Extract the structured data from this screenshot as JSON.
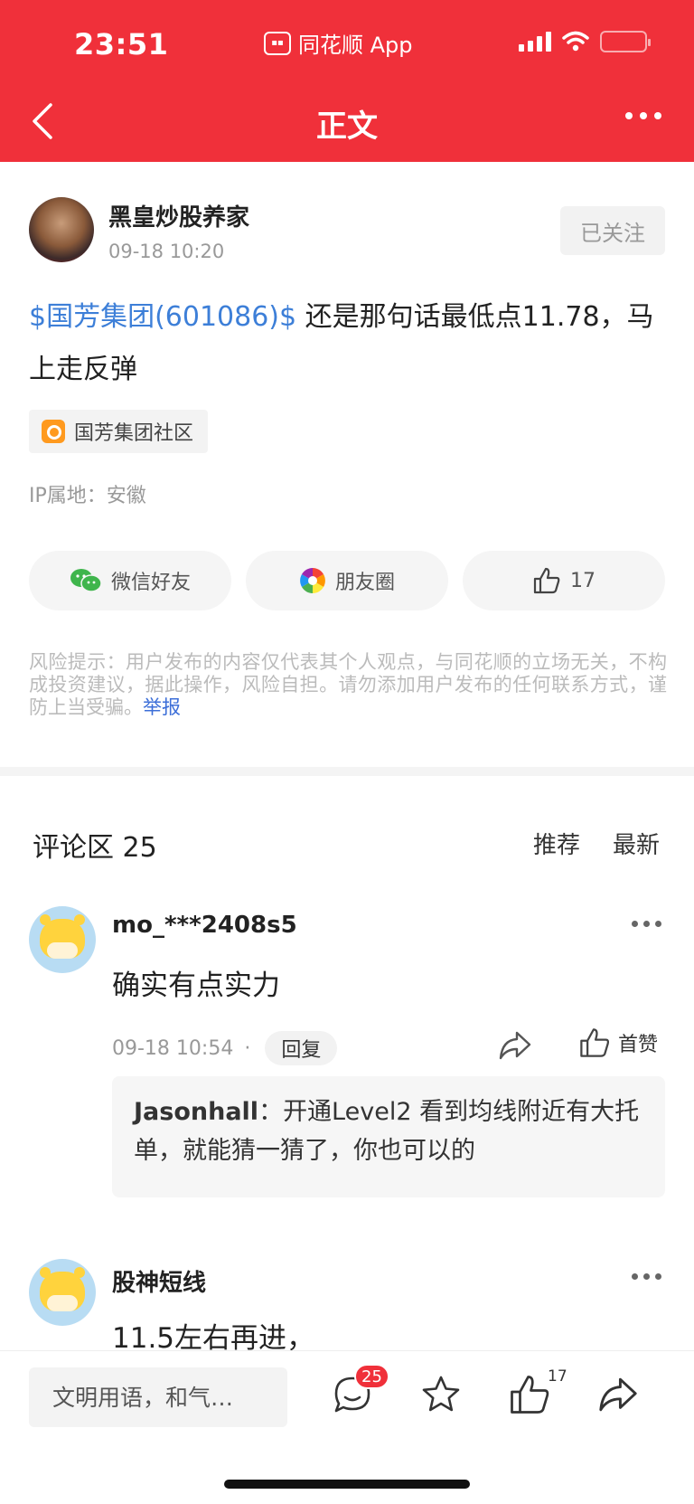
{
  "status_bar": {
    "time": "23:51",
    "app_label": "同花顺 App"
  },
  "nav": {
    "title": "正文"
  },
  "post": {
    "author_name": "黑皇炒股养家",
    "post_time": "09-18 10:20",
    "follow_label": "已关注",
    "stock_tag": "$国芳集团(601086)$",
    "content_text": " 还是那句话最低点11.78，马上走反弹",
    "community_label": "国芳集团社区",
    "ip_location": "IP属地：安徽",
    "share_wechat_label": "微信好友",
    "share_moments_label": "朋友圈",
    "like_count": "17",
    "risk_notice": "风险提示：用户发布的内容仅代表其个人观点，与同花顺的立场无关，不构成投资建议，据此操作，风险自担。请勿添加用户发布的任何联系方式，谨防上当受骗。",
    "report_label": "举报"
  },
  "comments": {
    "title": "评论区 25",
    "sort_recommended": "推荐",
    "sort_latest": "最新",
    "items": [
      {
        "user": "mo_***2408s5",
        "text": "确实有点实力",
        "time": "09-18 10:54",
        "separator": "·",
        "reply_label": "回复",
        "like_label": "首赞",
        "reply": {
          "user": "Jasonhall",
          "separator": "：",
          "text": "开通Level2 看到均线附近有大托单，就能猜一猜了，你也可以的"
        }
      },
      {
        "user": "股神短线",
        "text": "11.5左右再进，"
      }
    ]
  },
  "bottom_bar": {
    "input_placeholder": "文明用语，和气…",
    "comment_badge": "25",
    "like_count": "17"
  },
  "colors": {
    "brand_red": "#f0303a",
    "stock_link_blue": "#3d7fd8",
    "community_orange": "#ff9a1f"
  },
  "icons": [
    "back-icon",
    "more-icon",
    "wechat-icon",
    "moments-icon",
    "thumb-up-icon",
    "forward-icon",
    "comment-icon",
    "star-icon"
  ]
}
